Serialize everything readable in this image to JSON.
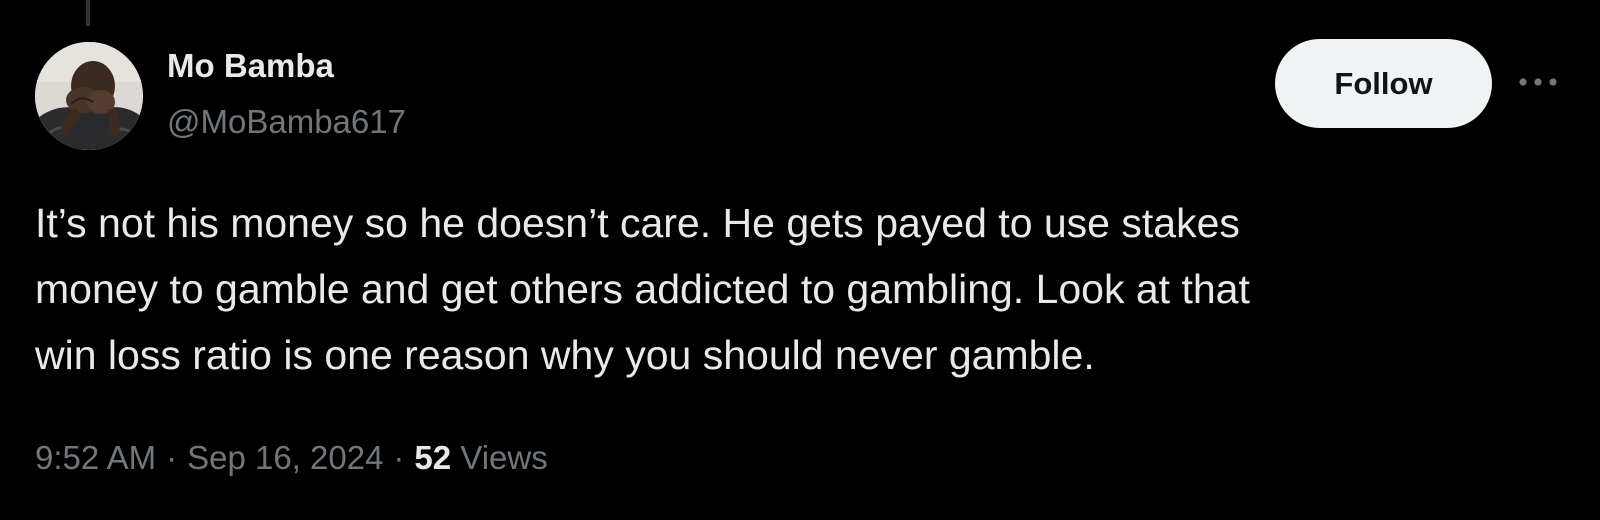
{
  "tweet": {
    "author": {
      "display_name": "Mo Bamba",
      "handle": "@MoBamba617",
      "avatar_icon": "user-avatar-photo"
    },
    "follow_label": "Follow",
    "more_icon": "more-horizontal-icon",
    "text_lines": [
      "It’s not his money so he doesn’t care. He gets payed to use stakes",
      "money to gamble and get others addicted to gambling. Look at that",
      "win loss ratio is one reason why you should never gamble."
    ],
    "time": "9:52 AM",
    "date": "Sep 16, 2024",
    "separator": "·",
    "views_count": "52",
    "views_label": "Views"
  },
  "colors": {
    "background": "#000000",
    "primary_text": "#e7e9ea",
    "secondary_text": "#71767b",
    "follow_button_bg": "#eff3f4",
    "follow_button_text": "#0f1419"
  }
}
